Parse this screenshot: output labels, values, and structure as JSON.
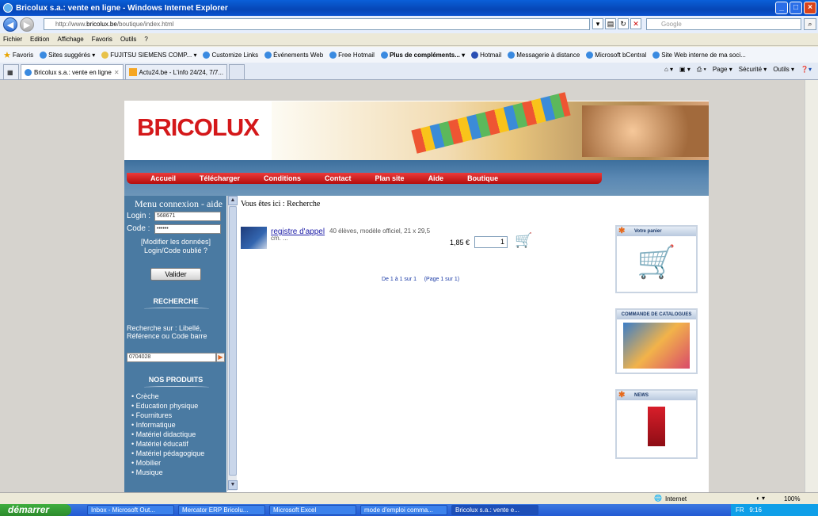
{
  "window": {
    "title": "Bricolux s.a.: vente en ligne - Windows Internet Explorer"
  },
  "address": {
    "prefix": "http://www.",
    "domain": "bricolux.be",
    "path": "/boutique/index.html",
    "search_placeholder": "Google"
  },
  "menu": [
    "Fichier",
    "Edition",
    "Affichage",
    "Favoris",
    "Outils",
    "?"
  ],
  "favorites": {
    "label": "Favoris",
    "links": [
      "Sites suggérés ▾",
      "FUJITSU SIEMENS COMP... ▾",
      "Customize Links",
      "Événements Web",
      "Free Hotmail",
      "Plus de compléments... ▾",
      "Hotmail",
      "Messagerie à distance",
      "Microsoft bCentral",
      "Site Web interne de ma soci..."
    ]
  },
  "tabs": [
    {
      "label": "Bricolux s.a.: vente en ligne"
    },
    {
      "label": "Actu24.be - L'info 24/24, 7/7..."
    }
  ],
  "command_bar": [
    "Page ▾",
    "Sécurité ▾",
    "Outils ▾"
  ],
  "site": {
    "logo": "BRICOLUX",
    "nav": [
      "Accueil",
      "Télécharger",
      "Conditions",
      "Contact",
      "Plan site",
      "Aide",
      "Boutique"
    ],
    "sidebar": {
      "title": "Menu connexion - aide",
      "login_label": "Login :",
      "login_value": "568671",
      "code_label": "Code :",
      "code_value": "••••••",
      "modify_link": "[Modifier les données]",
      "forgot_link": "Login/Code oublié ?",
      "validate": "Valider",
      "search_title": "RECHERCHE",
      "search_desc": "Recherche sur : Libellé, Référence ou Code barre",
      "search_value": "0704028",
      "products_title": "NOS PRODUITS",
      "products": [
        "Crèche",
        "Education physique",
        "Fournitures",
        "Informatique",
        "Matériel didactique",
        "Matériel éducatif",
        "Matériel pédagogique",
        "Mobilier",
        "Musique"
      ]
    },
    "breadcrumb": "Vous êtes ici : Recherche",
    "product": {
      "name": "registre d'appel",
      "desc": "40 élèves, modèle officiel, 21 x 29,5 cm. ...",
      "price": "1,85 €",
      "qty": "1"
    },
    "pager": "De 1 à 1 sur 1     (Page 1 sur 1)",
    "boxes": {
      "cart": "Votre panier",
      "catalog": "COMMANDE DE CATALOGUES",
      "news": "NEWS"
    }
  },
  "status": {
    "zone": "Internet",
    "zoom": "100%"
  },
  "taskbar": {
    "start": "démarrer",
    "items": [
      "Inbox - Microsoft Out...",
      "Mercator ERP Bricolu...",
      "Microsoft Excel",
      "mode d'emploi comma...",
      "Bricolux s.a.: vente e..."
    ],
    "tray": "FR   9:16"
  }
}
